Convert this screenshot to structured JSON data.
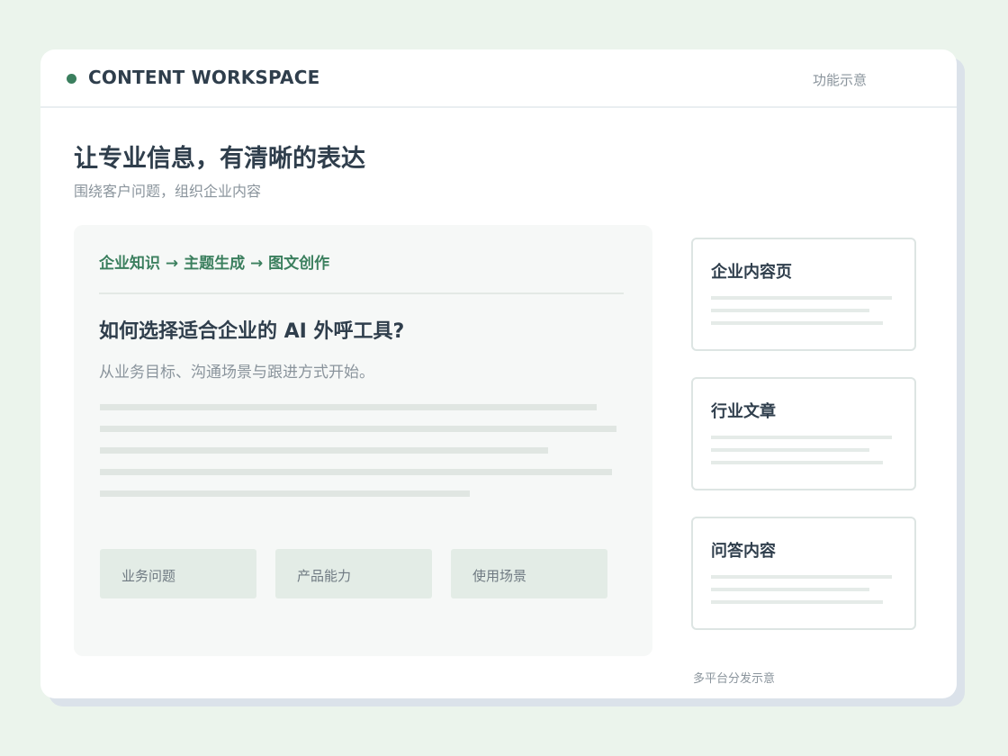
{
  "header": {
    "brand": "CONTENT WORKSPACE",
    "note": "功能示意"
  },
  "hero": {
    "title": "让专业信息，有清晰的表达",
    "subtitle": "围绕客户问题，组织企业内容"
  },
  "editor": {
    "flow": "企业知识 → 主题生成 → 图文创作",
    "article_title": "如何选择适合企业的 AI 外呼工具?",
    "article_summary": "从业务目标、沟通场景与跟进方式开始。",
    "tags": [
      "业务问题",
      "产品能力",
      "使用场景"
    ]
  },
  "channels": {
    "items": [
      {
        "title": "企业内容页"
      },
      {
        "title": "行业文章"
      },
      {
        "title": "问答内容"
      }
    ],
    "footnote": "多平台分发示意"
  },
  "colors": {
    "accent": "#3b7f5e",
    "page_background": "#ebf4ec",
    "text_primary": "#2f3e4c",
    "text_muted": "#8a949c"
  },
  "icons": {
    "brand": "status-dot-icon"
  }
}
